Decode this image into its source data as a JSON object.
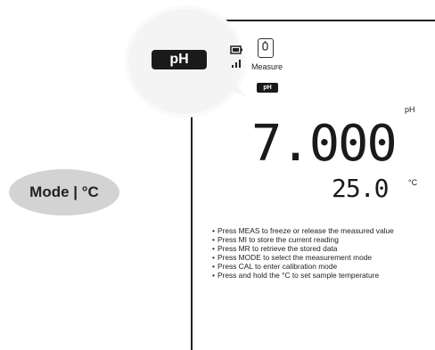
{
  "display": {
    "mode_indicator_large": "pH",
    "mode_indicator_small": "pH",
    "measure_label": "Measure",
    "measure_icon": "beaker-icon",
    "battery_icon": "battery-icon",
    "signal_icon": "signal-bars-icon",
    "reading_value": "7.000",
    "reading_unit": "pH",
    "temperature_value": "25.0",
    "temperature_unit": "°C"
  },
  "mode_button": {
    "label": "Mode | °C"
  },
  "instructions": [
    "Press MEAS to freeze or release the measured value",
    "Press MI to store the current reading",
    "Press MR to retrieve the stored data",
    "Press MODE to select the measurement mode",
    "Press CAL to enter calibration mode",
    "Press and hold the °C to set sample temperature"
  ]
}
